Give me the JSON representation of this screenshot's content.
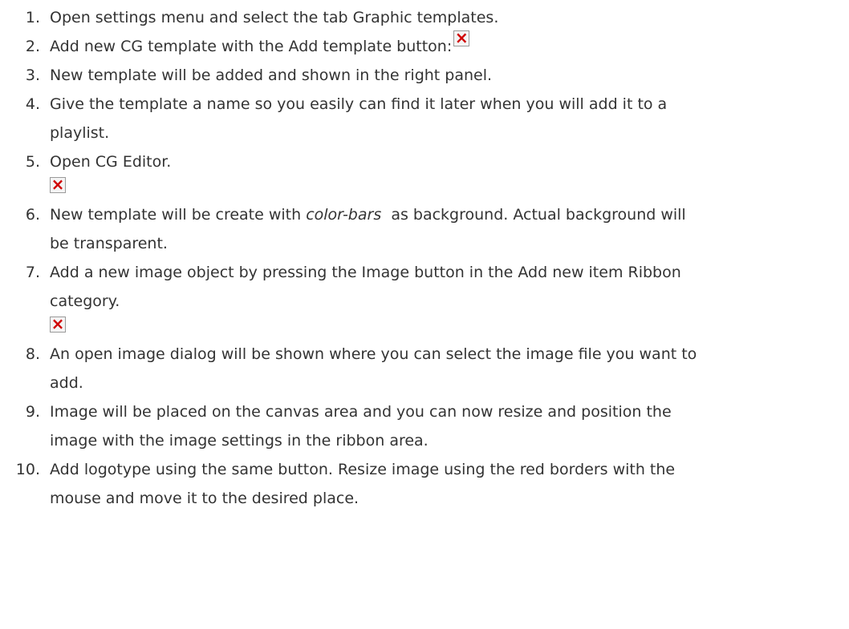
{
  "steps": [
    {
      "number": "1.",
      "text": "Open settings menu and select the tab Graphic templates."
    },
    {
      "number": "2.",
      "text": "Add new CG template with the Add template button:"
    },
    {
      "number": "3.",
      "text": "New template will be added and shown in the right panel."
    },
    {
      "number": "4.",
      "line1": "Give the template a name so you easily can find it later when you will add it to a",
      "line2": "playlist."
    },
    {
      "number": "5.",
      "text": "Open CG Editor."
    },
    {
      "number": "6.",
      "pre": "New template will be create with ",
      "em": "color-bars",
      "post": "  as background. Actual background will",
      "line2": "be transparent."
    },
    {
      "number": "7.",
      "line1": "Add a new image object by pressing the Image button in the Add new item Ribbon",
      "line2": "category."
    },
    {
      "number": "8.",
      "line1": "An open image dialog will be shown where you can select the image file you want to",
      "line2": "add."
    },
    {
      "number": "9.",
      "line1": "Image will be placed on the canvas area and you can now resize and position the",
      "line2": "image with the image settings in the ribbon area."
    },
    {
      "number": "10.",
      "line1": "Add logotype using the same button. Resize image using the red borders with the",
      "line2": "mouse and move it to the desired place."
    }
  ],
  "icons": {
    "broken_image": "broken-image-icon",
    "broken_image_color": "#d00000"
  }
}
